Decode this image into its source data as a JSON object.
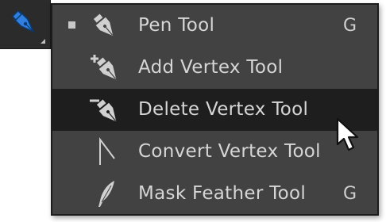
{
  "toolbar": {
    "active_tool_icon": "pen-icon",
    "accent": "#2f7fe0"
  },
  "menu": {
    "items": [
      {
        "label": "Pen Tool",
        "shortcut": "G",
        "icon": "pen-icon",
        "selected": true,
        "highlighted": false
      },
      {
        "label": "Add Vertex Tool",
        "shortcut": "",
        "icon": "add-vertex-icon",
        "selected": false,
        "highlighted": false
      },
      {
        "label": "Delete Vertex Tool",
        "shortcut": "",
        "icon": "delete-vertex-icon",
        "selected": false,
        "highlighted": true
      },
      {
        "label": "Convert Vertex Tool",
        "shortcut": "",
        "icon": "convert-vertex-icon",
        "selected": false,
        "highlighted": false
      },
      {
        "label": "Mask Feather Tool",
        "shortcut": "G",
        "icon": "mask-feather-icon",
        "selected": false,
        "highlighted": false
      }
    ]
  },
  "colors": {
    "menu_bg": "#424242",
    "highlight_bg": "#1e1e1e",
    "text": "#d6d6d6"
  }
}
